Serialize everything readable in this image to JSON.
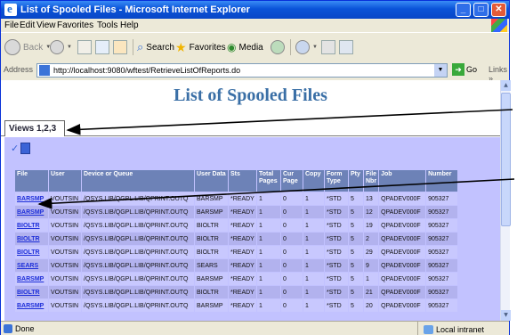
{
  "window": {
    "title": "List of Spooled Files - Microsoft Internet Explorer",
    "buttons": {
      "minimize": "_",
      "maximize": "□",
      "close": "✕"
    }
  },
  "menu": [
    "File",
    "Edit",
    "View",
    "Favorites",
    "Tools",
    "Help"
  ],
  "toolbar": {
    "back_label": "Back",
    "search_label": "Search",
    "favorites_label": "Favorites",
    "media_label": "Media"
  },
  "address": {
    "label": "Address",
    "url": "http://localhost:9080/wftest/RetrieveListOfReports.do",
    "go_label": "Go",
    "links_label": "Links »"
  },
  "page": {
    "title": "List of Spooled Files",
    "tab_label": "Views 1,2,3"
  },
  "table": {
    "headers": [
      "File",
      "User",
      "Device or Queue",
      "User Data",
      "Sts",
      "Total Pages",
      "Cur Page",
      "Copy",
      "Form Type",
      "Pty",
      "File Nbr",
      "Job",
      "Number"
    ],
    "rows": [
      [
        "BARSMP",
        "VOUTSIN",
        "/QSYS.LIB/QGPL.LIB/QPRINT.OUTQ",
        "BARSMP",
        "*READY",
        "1",
        "0",
        "1",
        "*STD",
        "5",
        "13",
        "QPADEV000F",
        "905327"
      ],
      [
        "BARSMP",
        "VOUTSIN",
        "/QSYS.LIB/QGPL.LIB/QPRINT.OUTQ",
        "BARSMP",
        "*READY",
        "1",
        "0",
        "1",
        "*STD",
        "5",
        "12",
        "QPADEV000F",
        "905327"
      ],
      [
        "BIOLTR",
        "VOUTSIN",
        "/QSYS.LIB/QGPL.LIB/QPRINT.OUTQ",
        "BIOLTR",
        "*READY",
        "1",
        "0",
        "1",
        "*STD",
        "5",
        "19",
        "QPADEV000F",
        "905327"
      ],
      [
        "BIOLTR",
        "VOUTSIN",
        "/QSYS.LIB/QGPL.LIB/QPRINT.OUTQ",
        "BIOLTR",
        "*READY",
        "1",
        "0",
        "1",
        "*STD",
        "5",
        "2",
        "QPADEV000F",
        "905327"
      ],
      [
        "BIOLTR",
        "VOUTSIN",
        "/QSYS.LIB/QGPL.LIB/QPRINT.OUTQ",
        "BIOLTR",
        "*READY",
        "1",
        "0",
        "1",
        "*STD",
        "5",
        "29",
        "QPADEV000F",
        "905327"
      ],
      [
        "SEARS",
        "VOUTSIN",
        "/QSYS.LIB/QGPL.LIB/QPRINT.OUTQ",
        "SEARS",
        "*READY",
        "1",
        "0",
        "1",
        "*STD",
        "5",
        "9",
        "QPADEV000F",
        "905327"
      ],
      [
        "BARSMP",
        "VOUTSIN",
        "/QSYS.LIB/QGPL.LIB/QPRINT.OUTQ",
        "BARSMP",
        "*READY",
        "1",
        "0",
        "1",
        "*STD",
        "5",
        "1",
        "QPADEV000F",
        "905327"
      ],
      [
        "BIOLTR",
        "VOUTSIN",
        "/QSYS.LIB/QGPL.LIB/QPRINT.OUTQ",
        "BIOLTR",
        "*READY",
        "1",
        "0",
        "1",
        "*STD",
        "5",
        "21",
        "QPADEV000F",
        "905327"
      ],
      [
        "BARSMP",
        "VOUTSIN",
        "/QSYS.LIB/QGPL.LIB/QPRINT.OUTQ",
        "BARSMP",
        "*READY",
        "1",
        "0",
        "1",
        "*STD",
        "5",
        "20",
        "QPADEV000F",
        "905327"
      ]
    ]
  },
  "status": {
    "text": "Done",
    "zone": "Local intranet"
  },
  "colors": {
    "title_blue": "#3a6fa6",
    "panel": "#c2c2ff",
    "header": "#6d82b7",
    "link": "#1e2fd9"
  }
}
